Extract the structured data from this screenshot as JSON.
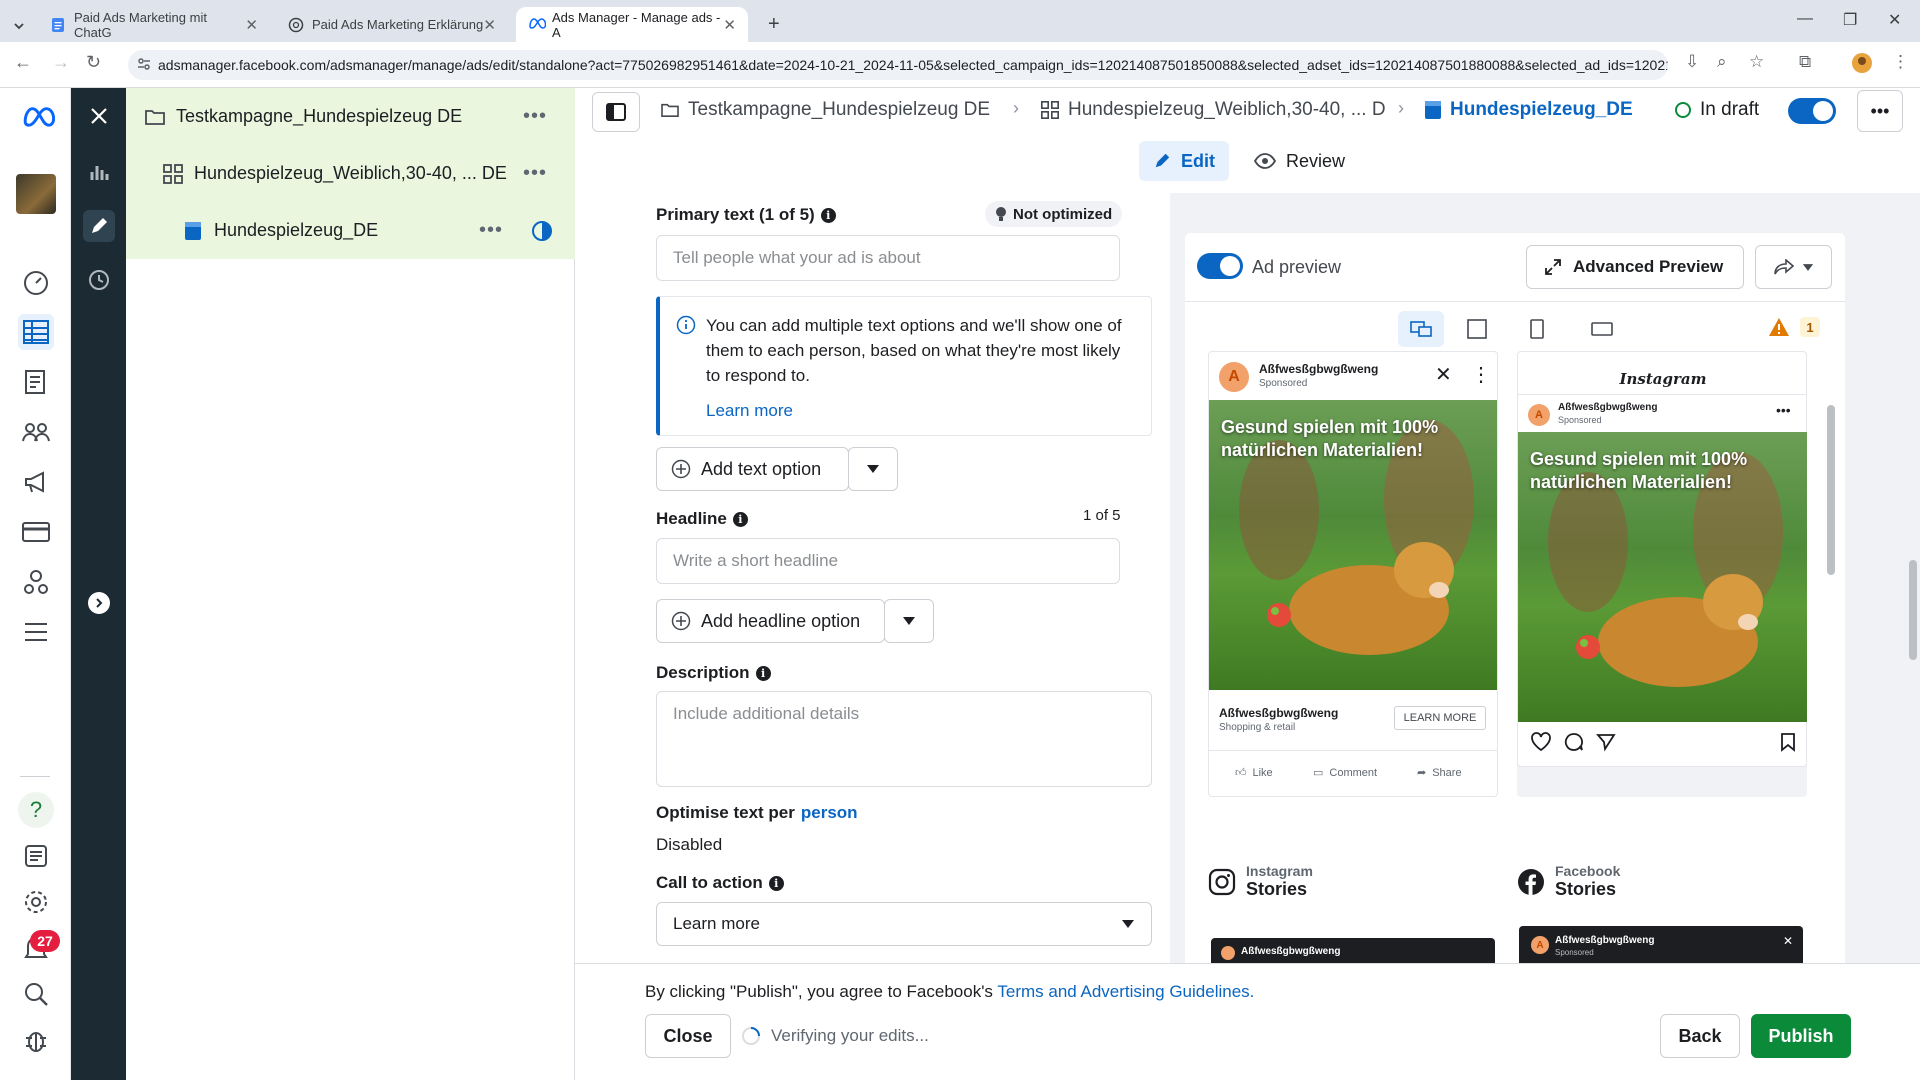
{
  "browser": {
    "tabs": [
      {
        "title": "Paid Ads Marketing mit ChatG"
      },
      {
        "title": "Paid Ads Marketing Erklärung"
      },
      {
        "title": "Ads Manager - Manage ads - A"
      }
    ],
    "url": "adsmanager.facebook.com/adsmanager/manage/ads/edit/standalone?act=775026982951461&date=2024-10-21_2024-11-05&selected_campaign_ids=120214087501850088&selected_adset_ids=120214087501880088&selected_ad_ids=120214..."
  },
  "rail": {
    "notification_count": "27"
  },
  "tree": {
    "campaign": "Testkampagne_Hundespielzeug DE",
    "adset": "Hundespielzeug_Weiblich,30-40, ... DE",
    "ad": "Hundespielzeug_DE",
    "more": "•••"
  },
  "toolbar": {
    "crumb_campaign": "Testkampagne_Hundespielzeug DE",
    "crumb_adset": "Hundespielzeug_Weiblich,30-40, ... D",
    "crumb_ad": "Hundespielzeug_DE",
    "status": "In draft",
    "edit": "Edit",
    "review": "Review",
    "more": "•••"
  },
  "form": {
    "primary_text_label": "Primary text (1 of 5)",
    "not_optimized": "Not optimized",
    "primary_placeholder": "Tell people what your ad is about",
    "tip_text": "You can add multiple text options and we'll show one of them to each person, based on what they're most likely to respond to.",
    "tip_link": "Learn more",
    "add_text_option": "Add text option",
    "headline_label": "Headline",
    "headline_count": "1 of 5",
    "headline_placeholder": "Write a short headline",
    "add_headline_option": "Add headline option",
    "description_label": "Description",
    "description_placeholder": "Include additional details",
    "optimise_label": "Optimise text per",
    "optimise_link": "person",
    "optimise_value": "Disabled",
    "cta_label": "Call to action",
    "cta_value": "Learn more"
  },
  "preview": {
    "toggle_label": "Ad preview",
    "advanced_preview": "Advanced Preview",
    "warning_count": "1",
    "fb_page": "Aßfwesßgbwgßweng",
    "fb_sponsored": "Sponsored",
    "ad_headline": "Gesund spielen mit 100% natürlichen Materialien!",
    "fb_footer_name": "Aßfwesßgbwgßweng",
    "fb_footer_cat": "Shopping & retail",
    "fb_cta": "LEARN MORE",
    "like": "Like",
    "comment": "Comment",
    "share": "Share",
    "ig_logo": "Instagram",
    "ig_page": "Aßfwesßgbwgßweng",
    "ig_sponsored": "Sponsored",
    "stories_ig_brand": "Instagram",
    "stories_ig": "Stories",
    "stories_fb_brand": "Facebook",
    "stories_fb": "Stories",
    "story_page": "Aßfwesßgbwgßweng",
    "story_sponsored": "Sponsored"
  },
  "footer": {
    "terms_prefix": "By clicking \"Publish\", you agree to Facebook's",
    "terms_link": "Terms and Advertising Guidelines.",
    "close": "Close",
    "verifying": "Verifying your edits...",
    "back": "Back",
    "publish": "Publish"
  },
  "colors": {
    "accent": "#0a66c2",
    "publish_green": "#0b8a3a",
    "tree_selected": "#eaf6de",
    "rail_dark": "#1c2b33",
    "badge_red": "#e41e3f"
  }
}
